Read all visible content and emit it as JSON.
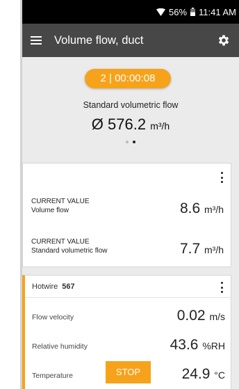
{
  "statusbar": {
    "battery": "56%",
    "time": "11:41 AM",
    "wifi_icon": "wifi-icon",
    "battery_icon": "battery-icon"
  },
  "appbar": {
    "title": "Volume flow, duct",
    "menu_icon": "menu-icon",
    "settings_icon": "gear-icon"
  },
  "summary": {
    "timer": "2 | 00:00:08",
    "label": "Standard volumetric flow",
    "value": "Ø 576.2",
    "unit": "m³/h",
    "page_count": 2,
    "active_page": 2
  },
  "current_values": [
    {
      "heading": "CURRENT VALUE",
      "name": "Volume flow",
      "value": "8.6",
      "unit": "m³/h"
    },
    {
      "heading": "CURRENT VALUE",
      "name": "Standard volumetric flow",
      "value": "7.7",
      "unit": "m³/h"
    }
  ],
  "probe": {
    "name": "Hotwire",
    "id": "567",
    "readings": [
      {
        "name": "Flow velocity",
        "value": "0.02",
        "unit": "m/s"
      },
      {
        "name": "Relative humidity",
        "value": "43.6",
        "unit": "%RH"
      },
      {
        "name": "Temperature",
        "value": "24.9",
        "unit": "°C"
      }
    ]
  },
  "stop_label": "STOP",
  "colors": {
    "accent": "#f7a21b",
    "appbar": "#474747",
    "background": "#ebebeb",
    "statusbar": "#000000"
  }
}
